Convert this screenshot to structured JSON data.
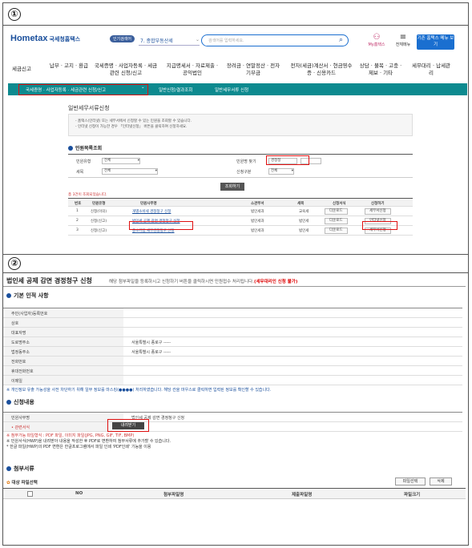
{
  "steps": [
    "①",
    "②"
  ],
  "header": {
    "logo": "Hometax",
    "logo_sub": "국세청홈택스",
    "pill": "인기검색어",
    "select_value": "7. 종합부동산세",
    "search_placeholder": "검색어를 입력하세요.",
    "my_label": "My홈택스",
    "menu_label": "전체메뉴",
    "old_button": "기존 홈택스 메뉴 보기"
  },
  "main_nav": [
    "세금신고",
    "납부 · 고지 · 환급",
    "국세증명 · 사업자등록 · 세금관련 신청/신고",
    "지급명세서 · 자료제출 · 공익법인",
    "장려금 · 연말정산 · 전자기부금",
    "전자(세금)계산서 · 현금영수증 · 신용카드",
    "상담 · 불복 · 고충 · 제보 · 기타",
    "세무대리 · 납세관리"
  ],
  "sub_bar": {
    "crumb": "국세증명 · 사업자등록 · 세금관련 신청/신고",
    "crumb_arrow": "⌄",
    "items": [
      "일반신청/결과조회",
      "일반세무서류 신청"
    ]
  },
  "page": {
    "title": "일반세무서류신청",
    "notes": [
      "- 홈택스(인터넷) 또는 세무서에서 신청할 수 있는 민원을 조회할 수 있습니다.",
      "- 인터넷 신청이 가능한 경우 「인터넷신청」 버튼을 클릭하여 신청하세요."
    ]
  },
  "search_form": {
    "heading": "민원목록조회",
    "f1_label": "민원유형",
    "f1_value": "전체",
    "f2_label": "민원명 찾기",
    "f2_value": "경정청",
    "f3_label": "세목",
    "f3_value": "전체",
    "f4_label": "신청구분",
    "f4_value": "전체",
    "submit": "조회하기",
    "count": "총 3건이 조회되었습니다."
  },
  "results": {
    "headers": [
      "번호",
      "민원유형",
      "민원사무명",
      "소관부서",
      "세목",
      "신청서식",
      "신청하기"
    ],
    "rows": [
      {
        "no": "1",
        "type": "신청(이의)",
        "name": "개별소비세 경정청구 신청",
        "dept": "법인세과",
        "tax": "교육세",
        "form": "다운로드",
        "apply": "세무서신청"
      },
      {
        "no": "2",
        "type": "신청(신고)",
        "name": "법인세 공제 감면 경정청구 신청",
        "dept": "법인세과",
        "tax": "법인세",
        "form": "다운로드",
        "apply": "인터넷신청"
      },
      {
        "no": "3",
        "type": "신청(신고)",
        "name": "중소기업 세무경정청구 신청",
        "dept": "법인세과",
        "tax": "법인세",
        "form": "다운로드",
        "apply": "세무서신청"
      }
    ]
  },
  "panel2": {
    "title": "법인세 공제 감면 경정청구 신청",
    "subtitle": "해당 첨부파일을 등록하시고 신청하기 버튼을 클릭하시면 민원접수 처리됩니다.",
    "subtitle_red": "(세무대리인 신청 불가)",
    "basic_heading": "기본 인적 사항",
    "basic_rows": [
      {
        "k": "주민(사업자)등록번호",
        "v": ""
      },
      {
        "k": "상호",
        "v": ""
      },
      {
        "k": "대표자명",
        "v": ""
      },
      {
        "k": "도로명주소",
        "v": "서울특별시 종로구 -----"
      },
      {
        "k": "법정동주소",
        "v": "서울특별시 종로구 -----"
      },
      {
        "k": "전화번호",
        "v": ""
      },
      {
        "k": "휴대전화번호",
        "v": ""
      },
      {
        "k": "이메일",
        "v": ""
      }
    ],
    "privacy_note": "※ 개인정보 유출 가능성을 사전 차단하기 위해 일부 정보를 마스킹(●●●●) 처리하였습니다. 해당 칸을 마우스로 클릭하면 입력된 정보를 확인할 수 있습니다.",
    "apply_heading": "신청내용",
    "apply_rows": [
      {
        "k": "민원사무명",
        "v": "법인세 공제 감면 경정청구 신청"
      },
      {
        "k": "• 관련서식",
        "v": ""
      }
    ],
    "download_btn": "내려받기",
    "file_notes": [
      "※ 첨부가능 파일형식 : PDF 파일, 이미지 파일(JPG, PNG, GIF, TIF, BMP)",
      "※ 민원서식(HWP)을 내려받아 내용을 작성한 후 PDF로 변환하여 첨부서류에 추가할 수 있습니다.",
      "   * 한글 파일(HWP)의 PDF 변환은 한글프로그램에서 파일 인쇄 'PDF인쇄' 기능을 이용"
    ],
    "attach_heading": "첨부서류",
    "file_select_label": "대상 파일선택",
    "btn_select": "파일선택",
    "btn_delete": "삭제",
    "table_headers": [
      "NO",
      "첨부파일명",
      "제출파일명",
      "파일크기"
    ]
  }
}
